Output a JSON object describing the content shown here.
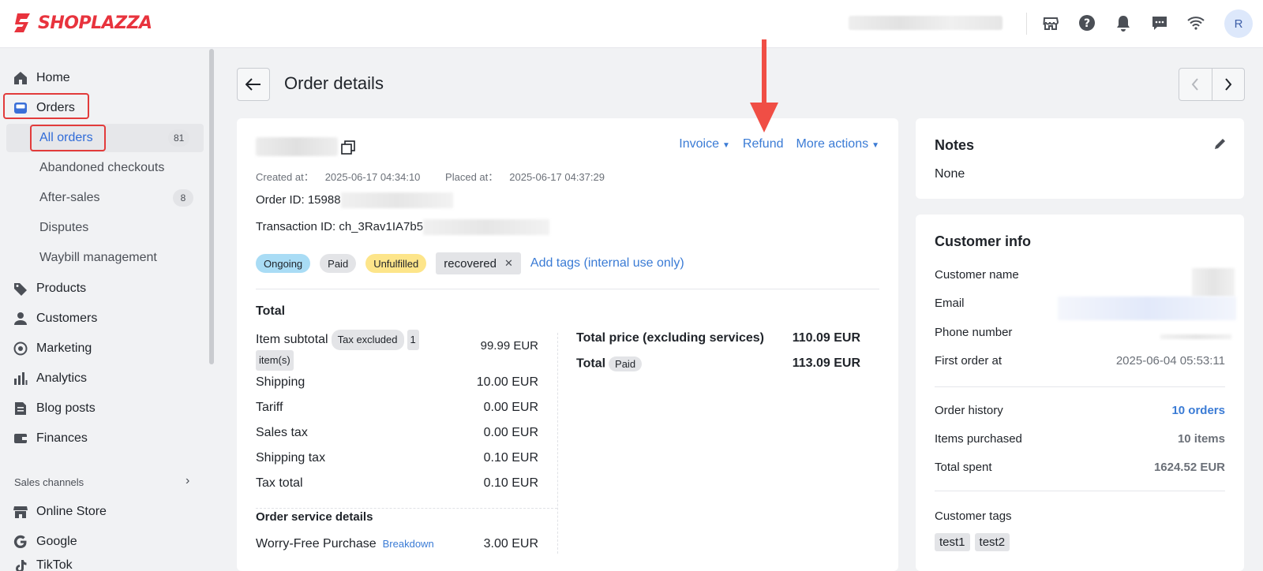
{
  "brand": {
    "name": "SHOPLAZZA",
    "color": "#e8333d"
  },
  "topbar": {
    "icons": [
      "store-icon",
      "help-icon",
      "bell-icon",
      "chat-icon",
      "wifi-icon"
    ],
    "avatar_initial": "R"
  },
  "sidebar": {
    "home": "Home",
    "orders": "Orders",
    "all_orders": "All orders",
    "all_orders_count": "81",
    "abandoned": "Abandoned checkouts",
    "after_sales": "After-sales",
    "after_sales_count": "8",
    "disputes": "Disputes",
    "waybill": "Waybill management",
    "products": "Products",
    "customers": "Customers",
    "marketing": "Marketing",
    "analytics": "Analytics",
    "blog": "Blog posts",
    "finances": "Finances",
    "sales_channels": "Sales channels",
    "online_store": "Online Store",
    "google": "Google",
    "partial": "TikTok"
  },
  "page": {
    "title": "Order details"
  },
  "order": {
    "actions": {
      "invoice": "Invoice",
      "refund": "Refund",
      "more": "More actions"
    },
    "created_label": "Created at：",
    "created_value": "2025-06-17 04:34:10",
    "placed_label": "Placed at：",
    "placed_value": "2025-06-17 04:37:29",
    "order_id": "Order ID: 15988",
    "transaction_id": "Transaction ID: ch_3Rav1IA7b5",
    "tags": {
      "ongoing": "Ongoing",
      "paid": "Paid",
      "unfulfilled": "Unfulfilled",
      "custom_tag": "recovered",
      "add_tags": "Add tags (internal use only)"
    }
  },
  "totals": {
    "title": "Total",
    "item_subtotal_label": "Item subtotal",
    "tax_excluded": "Tax excluded",
    "items_count_num": "1",
    "items_count_unit": "item(s)",
    "item_subtotal": "99.99 EUR",
    "rows": [
      {
        "label": "Shipping",
        "value": "10.00 EUR"
      },
      {
        "label": "Tariff",
        "value": "0.00 EUR"
      },
      {
        "label": "Sales tax",
        "value": "0.00 EUR"
      },
      {
        "label": "Shipping tax",
        "value": "0.10 EUR"
      },
      {
        "label": "Tax total",
        "value": "0.10 EUR"
      }
    ],
    "service_title": "Order service details",
    "worry_free_label": "Worry-Free Purchase",
    "breakdown": "Breakdown",
    "worry_free_value": "3.00 EUR",
    "total_price_label": "Total price (excluding services)",
    "total_price_value": "110.09 EUR",
    "total_label": "Total",
    "total_paid": "Paid",
    "total_value": "113.09 EUR"
  },
  "notes": {
    "title": "Notes",
    "value": "None"
  },
  "customer": {
    "title": "Customer info",
    "name_label": "Customer name",
    "email_label": "Email",
    "phone_label": "Phone number",
    "first_order_label": "First order at",
    "first_order_value": "2025-06-04 05:53:11",
    "order_history_label": "Order history",
    "order_history_value": "10 orders",
    "items_label": "Items purchased",
    "items_value": "10 items",
    "spent_label": "Total spent",
    "spent_value": "1624.52 EUR",
    "tags_label": "Customer tags",
    "tags": [
      "test1",
      "test2"
    ]
  }
}
